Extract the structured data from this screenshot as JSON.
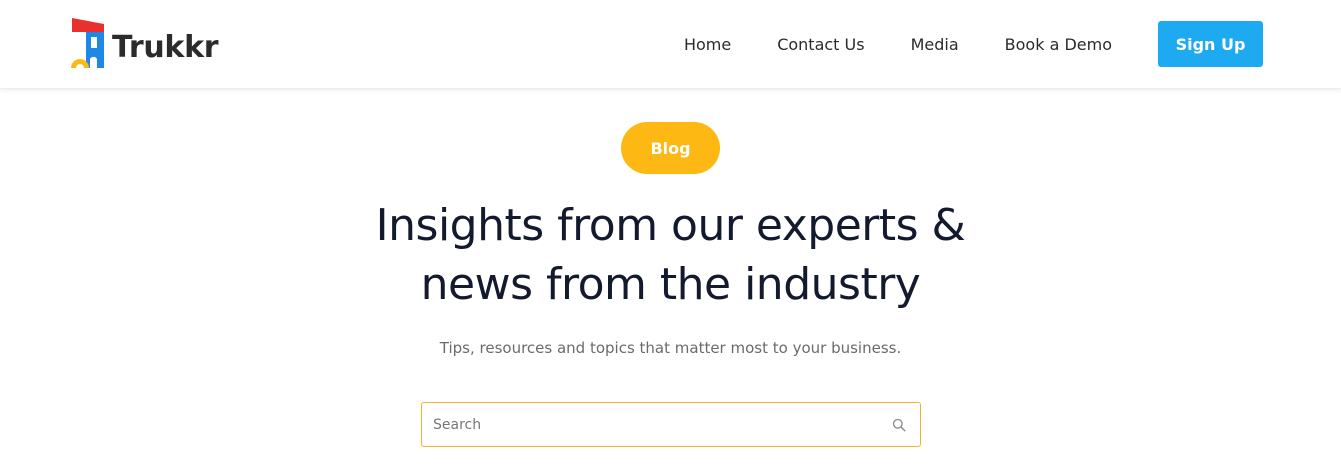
{
  "brand": {
    "name": "Trukkr",
    "logo_colors": {
      "roof": "#e8302f",
      "body": "#1e88e5",
      "wheel": "#fdb813"
    }
  },
  "nav": {
    "items": [
      {
        "label": "Home"
      },
      {
        "label": "Contact Us"
      },
      {
        "label": "Media"
      },
      {
        "label": "Book a Demo"
      }
    ],
    "signup_label": "Sign Up"
  },
  "hero": {
    "badge": "Blog",
    "headline_line1": "Insights from our experts &",
    "headline_line2": "news from the industry",
    "subtitle": "Tips, resources and topics that matter most to your business."
  },
  "search": {
    "placeholder": "Search",
    "value": "",
    "icon": "search-icon"
  },
  "colors": {
    "accent_blue": "#1eaaf1",
    "accent_yellow": "#fdb813",
    "headline": "#141a2e"
  }
}
